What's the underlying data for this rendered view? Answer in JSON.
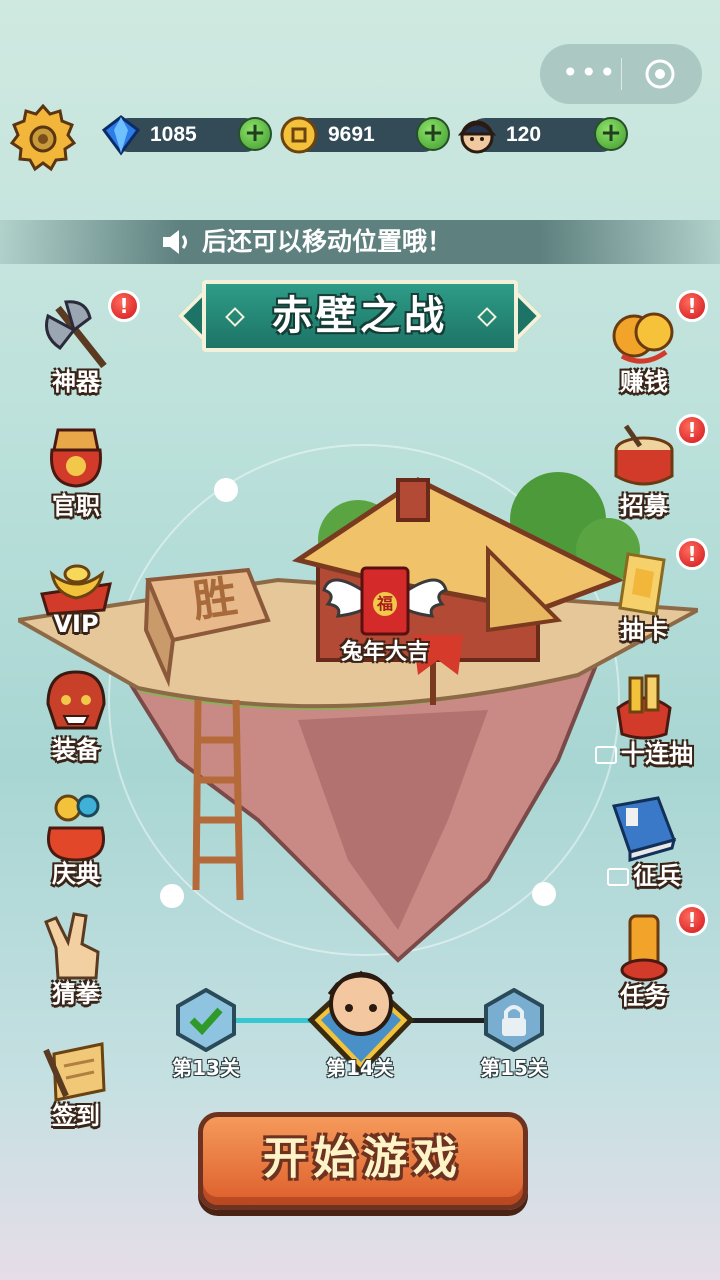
{
  "top_bar": {
    "capsule_more": "•••",
    "resources": [
      {
        "name": "gem",
        "value": "1085"
      },
      {
        "name": "coin",
        "value": "9691"
      },
      {
        "name": "soldier",
        "value": "120"
      }
    ],
    "plus": "+"
  },
  "notice": {
    "text": "后还可以移动位置哦！"
  },
  "banner": {
    "title": "赤壁之战"
  },
  "left_menu": [
    {
      "label": "神器",
      "badge": "!"
    },
    {
      "label": "官职"
    },
    {
      "label": "VIP"
    },
    {
      "label": "装备"
    },
    {
      "label": "庆典"
    },
    {
      "label": "猜拳"
    },
    {
      "label": "签到"
    }
  ],
  "right_menu": [
    {
      "label": "赚钱",
      "badge": "!"
    },
    {
      "label": "招募",
      "badge": "!"
    },
    {
      "label": "抽卡",
      "badge": "!"
    },
    {
      "label": "十连抽"
    },
    {
      "label": "征兵"
    },
    {
      "label": "任务",
      "badge": "!"
    }
  ],
  "island": {
    "sign": "胜",
    "event_label": "兔年大吉",
    "envelope_char": "福"
  },
  "levels": [
    {
      "label": "第13关",
      "state": "completed"
    },
    {
      "label": "第14关",
      "state": "current"
    },
    {
      "label": "第15关",
      "state": "locked"
    }
  ],
  "start_button": {
    "label": "开始游戏"
  },
  "colors": {
    "accent_green": "#3f9a2d",
    "banner_teal": "#1d7466",
    "start_orange": "#dd5e2c",
    "badge_red": "#d0161d"
  }
}
